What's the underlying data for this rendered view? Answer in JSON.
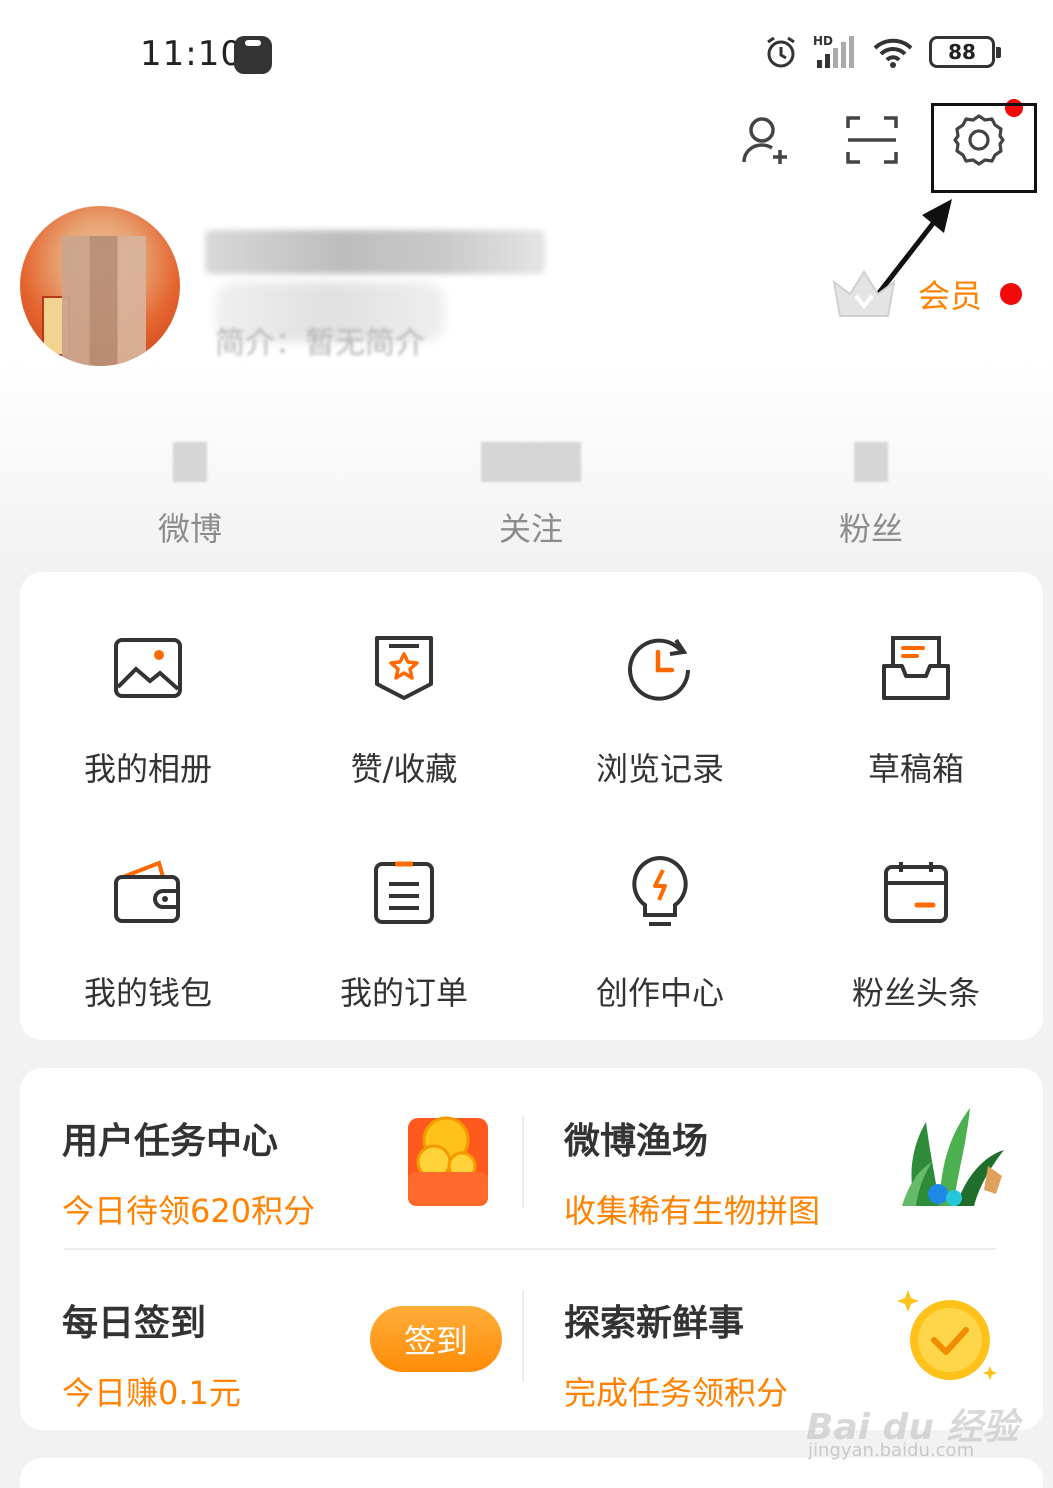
{
  "status_bar": {
    "time": "11:10",
    "battery": "88",
    "icons": [
      "alarm-icon",
      "hd-signal-icon",
      "wifi-icon",
      "battery-icon"
    ]
  },
  "top_actions": [
    "add-friend-icon",
    "scan-icon",
    "settings-icon"
  ],
  "profile": {
    "bio_prefix": "简介：暂无简介",
    "vip_label": "会员"
  },
  "stats": [
    {
      "label": "微博"
    },
    {
      "label": "关注"
    },
    {
      "label": "粉丝"
    }
  ],
  "grid": [
    {
      "label": "我的相册",
      "icon": "album-icon"
    },
    {
      "label": "赞/收藏",
      "icon": "favorite-icon"
    },
    {
      "label": "浏览记录",
      "icon": "history-icon"
    },
    {
      "label": "草稿箱",
      "icon": "drafts-icon"
    },
    {
      "label": "我的钱包",
      "icon": "wallet-icon"
    },
    {
      "label": "我的订单",
      "icon": "orders-icon"
    },
    {
      "label": "创作中心",
      "icon": "creator-bulb-icon"
    },
    {
      "label": "粉丝头条",
      "icon": "fans-headline-icon"
    }
  ],
  "tasks": [
    {
      "title": "用户任务中心",
      "sub": "今日待领620积分",
      "icon": "coin-box-icon"
    },
    {
      "title": "微博渔场",
      "sub": "收集稀有生物拼图",
      "icon": "plant-icon"
    },
    {
      "title": "每日签到",
      "sub": "今日赚0.1元",
      "button": "签到"
    },
    {
      "title": "探索新鲜事",
      "sub": "完成任务领积分",
      "icon": "gold-check-icon"
    }
  ],
  "watermark": {
    "main": "Bai du 经验",
    "sub": "jingyan.baidu.com"
  },
  "colors": {
    "accent": "#ff8200",
    "dot": "#f10a0a",
    "text": "#333333",
    "muted": "#8c8c8c"
  }
}
